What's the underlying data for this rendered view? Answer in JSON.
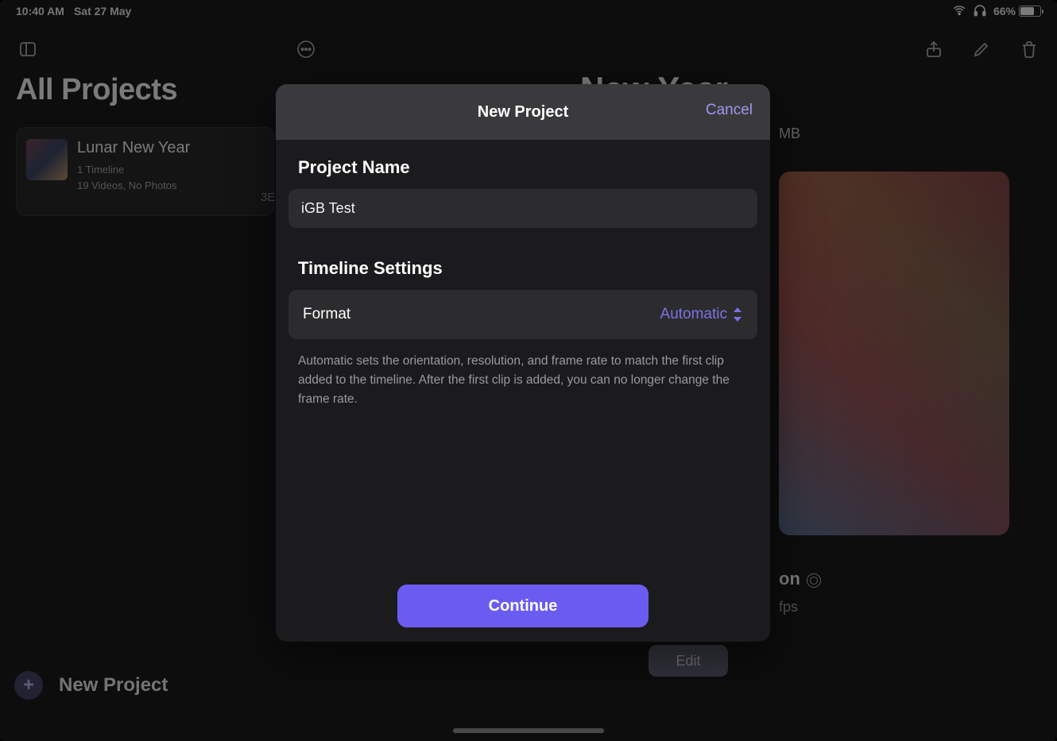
{
  "statusbar": {
    "time": "10:40 AM",
    "date": "Sat 27 May",
    "battery_pct": "66%"
  },
  "page": {
    "title": "All Projects",
    "bg_heading_partial": "New Year",
    "mb_partial": "MB",
    "on_partial": "on",
    "fps_partial": "fps"
  },
  "project_card": {
    "title": "Lunar New Year",
    "sub1": "1 Timeline",
    "sub2": "19 Videos, No Photos",
    "trailing": "3E"
  },
  "edit_chip": "Edit",
  "new_project_button": "New Project",
  "modal": {
    "title": "New Project",
    "cancel": "Cancel",
    "section_name_label": "Project Name",
    "project_name_value": "iGB Test",
    "section_timeline_label": "Timeline Settings",
    "format_label": "Format",
    "format_value": "Automatic",
    "help_text": "Automatic sets the orientation, resolution, and frame rate to match the first clip added to the timeline. After the first clip is added, you can no longer change the frame rate.",
    "continue": "Continue"
  }
}
